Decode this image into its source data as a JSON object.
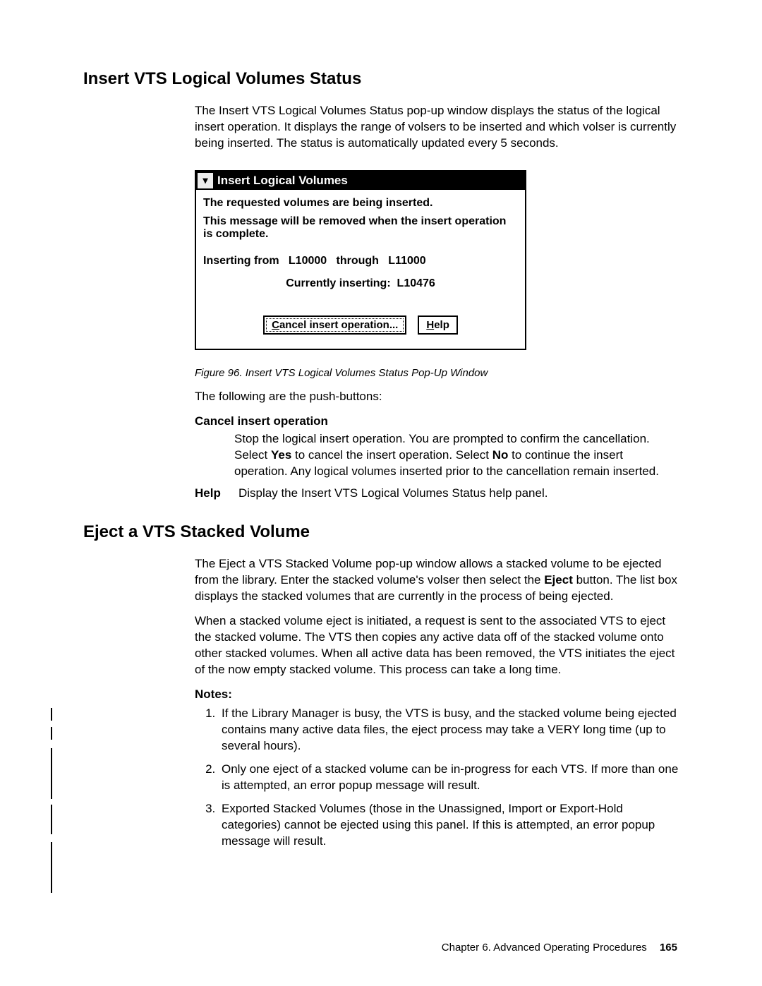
{
  "section1": {
    "heading": "Insert VTS Logical Volumes Status",
    "intro": "The Insert VTS Logical Volumes Status pop-up window displays the status of the logical insert operation. It displays the range of volsers to be inserted and which volser is currently being inserted. The status is automatically updated every 5 seconds."
  },
  "popup": {
    "title": "Insert Logical Volumes",
    "status_line": "The requested volumes are being inserted.",
    "message": "This message will be removed when the insert operation is complete.",
    "range_prefix": "Inserting from",
    "range_from": "L10000",
    "range_mid": "through",
    "range_to": "L11000",
    "current_prefix": "Currently inserting:",
    "current_volser": "L10476",
    "btn_cancel": "Cancel insert operation...",
    "btn_cancel_mn": "C",
    "btn_cancel_rest": "ancel insert operation...",
    "btn_help": "Help",
    "btn_help_mn": "H",
    "btn_help_rest": "elp"
  },
  "figure_caption": "Figure 96. Insert VTS Logical Volumes Status Pop-Up Window",
  "pushbuttons_intro": "The following are the push-buttons:",
  "pb": {
    "cancel": {
      "term": "Cancel insert operation",
      "desc_pre": "Stop the logical insert operation. You are prompted to confirm the cancellation. Select ",
      "yes": "Yes",
      "desc_mid": " to cancel the insert operation. Select ",
      "no": "No",
      "desc_post": " to continue the insert operation. Any logical volumes inserted prior to the cancellation remain inserted."
    },
    "help": {
      "term": "Help",
      "desc": "Display the Insert VTS Logical Volumes Status help panel."
    }
  },
  "section2": {
    "heading": "Eject a VTS Stacked Volume",
    "p1_pre": "The Eject a VTS Stacked Volume pop-up window allows a stacked volume to be ejected from the library. Enter the stacked volume's volser then select the ",
    "eject": "Eject",
    "p1_post": " button. The list box displays the stacked volumes that are currently in the process of being ejected.",
    "p2": "When a stacked volume eject is initiated, a request is sent to the associated VTS to eject the stacked volume. The VTS then copies any active data off of the stacked volume onto other stacked volumes. When all active data has been removed, the VTS initiates the eject of the now empty stacked volume. This process can take a long time.",
    "notes_heading": "Notes:",
    "notes": [
      "If the Library Manager is busy, the VTS is busy, and the stacked volume being ejected contains many active data files, the eject process may take a VERY long time (up to several hours).",
      "Only one eject of a stacked volume can be in-progress for each VTS. If more than one is attempted, an error popup message will result.",
      "Exported Stacked Volumes (those in the Unassigned, Import or Export-Hold categories) cannot be ejected using this panel. If this is attempted, an error popup message will result."
    ]
  },
  "footer": {
    "chapter": "Chapter 6. Advanced Operating Procedures",
    "page": "165"
  }
}
